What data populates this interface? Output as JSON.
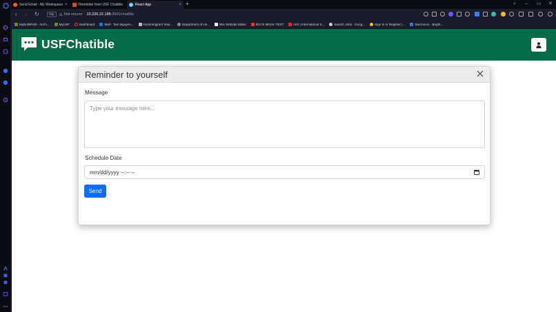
{
  "browser": {
    "tabs": [
      {
        "title": "Send Email - My Workspace",
        "color": "#e8612c"
      },
      {
        "title": "Reminder from USF Chatible",
        "color": "#d44638"
      },
      {
        "title": "React App",
        "color": "#61dafb"
      }
    ],
    "new_tab": "+",
    "address": {
      "badge": "http",
      "warning": "Not secure",
      "host": "10.226.22.185",
      "path": ":3001/chatMe"
    },
    "bookmarks": [
      {
        "label": "MyBullsPath - Archi...",
        "color": "#6a8a2a"
      },
      {
        "label": "MyUSF",
        "color": "#6a8a2a"
      },
      {
        "label": "Dashboard",
        "color": "#e04020"
      },
      {
        "label": "Mail - Tam Nguyen...",
        "color": "#1e6fd9"
      },
      {
        "label": "Nonimmigrant Visa...",
        "color": "#c0c0c0"
      },
      {
        "label": "Department of Ho...",
        "color": "#8a8a9a"
      },
      {
        "label": "Wix Website Editor",
        "color": "#f0f0f0"
      },
      {
        "label": "IELTS MOCK TEST",
        "color": "#e03030"
      },
      {
        "label": "ISO | International S...",
        "color": "#d03030"
      },
      {
        "label": "Search Jobs - Goog...",
        "color": "#d0d0d0"
      },
      {
        "label": "Sign in or Register |...",
        "color": "#f0c020"
      },
      {
        "label": "Starrooms - Bright...",
        "color": "#3a7ae0"
      }
    ]
  },
  "app": {
    "brand": "USFChatible",
    "colors": {
      "appbar": "#036b47",
      "primary": "#0d6efd"
    }
  },
  "modal": {
    "title": "Reminder to yourself",
    "message_label": "Message",
    "message_placeholder": "Type your message here...",
    "date_label": "Schedule Date",
    "date_value": "mm/dd/yyyy --:-- --",
    "send_label": "Send"
  }
}
